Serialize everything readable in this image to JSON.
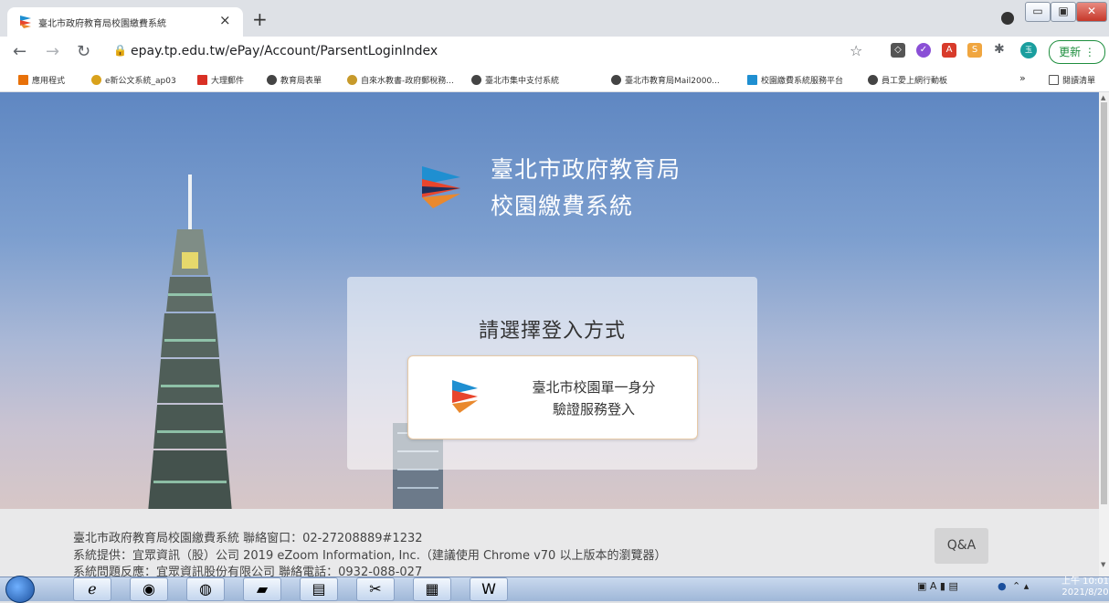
{
  "browser": {
    "tab_title": "臺北市政府教育局校園繳費系統",
    "tab_close": "×",
    "new_tab": "+",
    "url": "epay.tp.edu.tw/ePay/Account/ParsentLoginIndex",
    "update_label": "更新",
    "window_buttons": {
      "minimize": "▭",
      "restore": "▣",
      "close": "✕"
    }
  },
  "bookmarks": [
    "應用程式",
    "e新公文系統_ap03",
    "大理郵件",
    "教育局表單",
    "自來水教書-政府郵稅務...",
    "臺北市集中支付系統",
    "臺北市教育局Mail2000...",
    "校園繳費系統服務平台",
    "員工愛上網行動板"
  ],
  "bookmarks_overflow": "»",
  "reading_list": "閱讀清單",
  "brand": {
    "line1": "臺北市政府教育局",
    "line2": "校園繳費系統"
  },
  "login": {
    "title": "請選擇登入方式",
    "button_line1": "臺北市校園單一身分",
    "button_line2": "驗證服務登入"
  },
  "footer": {
    "line1": "臺北市政府教育局校園繳費系統 聯絡窗口：02-27208889#1232",
    "line2": "系統提供：宜眾資訊（股）公司 2019 eZoom Information, Inc.（建議使用 Chrome v70 以上版本的瀏覽器）",
    "line3": "系統問題反應：宜眾資訊股份有限公司 聯絡電話：0932-088-027",
    "qa_label": "Q&A"
  },
  "taskbar": {
    "time": "上午 10:01",
    "date": "2021/8/20"
  },
  "colors": {
    "logo_blue": "#1f8fd1",
    "logo_red": "#e8452c",
    "logo_orange": "#e9892e",
    "logo_navy": "#1d2f5a",
    "update_green": "#1e8e3e"
  }
}
